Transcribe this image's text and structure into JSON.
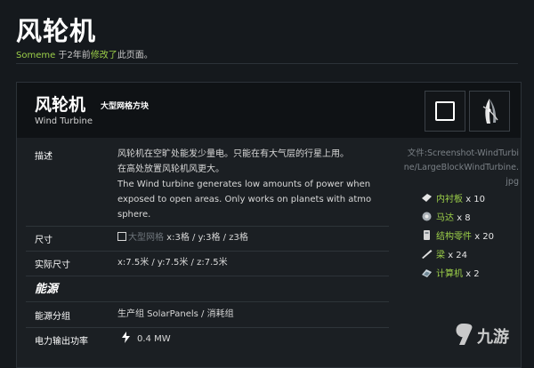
{
  "page": {
    "title": "风轮机",
    "edit_user": "Someme",
    "edit_prefix": " 于2年前",
    "edit_link": "修改了",
    "edit_suffix": "此页面。"
  },
  "block": {
    "name_cn": "风轮机",
    "kind": "大型网格方块",
    "name_en": "Wind Turbine",
    "icons": [
      "square-block-icon",
      "wind-turbine-icon"
    ]
  },
  "rows": {
    "desc_label": "描述",
    "desc_cn_1": "风轮机在空旷处能发少量电。只能在有大气层的行星上用。",
    "desc_cn_2": "在高处放置风轮机风更大。",
    "desc_en_1": "The Wind turbine generates low amounts of power when",
    "desc_en_2": "exposed to open areas. Only works on planets with atmo",
    "desc_en_3": "sphere.",
    "size_label": "尺寸",
    "size_grid": "大型网格",
    "size_value": " x:3格 / y:3格 / z3格",
    "real_size_label": "实际尺寸",
    "real_size_value": "x:7.5米 / y:7.5米 / z:7.5米",
    "energy_section": "能源",
    "energy_group_label": "能源分组",
    "energy_group_value": "生产组 SolarPanels / 消耗组",
    "power_label": "电力输出功率",
    "power_value": "0.4 MW"
  },
  "side": {
    "file_label": "文件:Screenshot-WindTurbine/LargeBlockWindTurbine.jpg",
    "components": [
      {
        "name": "内衬板",
        "count": "x 10",
        "icon": "interior-plate-icon"
      },
      {
        "name": "马达",
        "count": "x 8",
        "icon": "motor-icon"
      },
      {
        "name": "结构零件",
        "count": "x 20",
        "icon": "construction-component-icon"
      },
      {
        "name": "梁",
        "count": "x 24",
        "icon": "girder-icon"
      },
      {
        "name": "计算机",
        "count": "x 2",
        "icon": "computer-icon"
      }
    ]
  },
  "watermark": {
    "text": "九游"
  },
  "colors": {
    "accent": "#9ccf49",
    "background": "#15191d",
    "card": "#1b1f23",
    "header": "#0f1215"
  }
}
